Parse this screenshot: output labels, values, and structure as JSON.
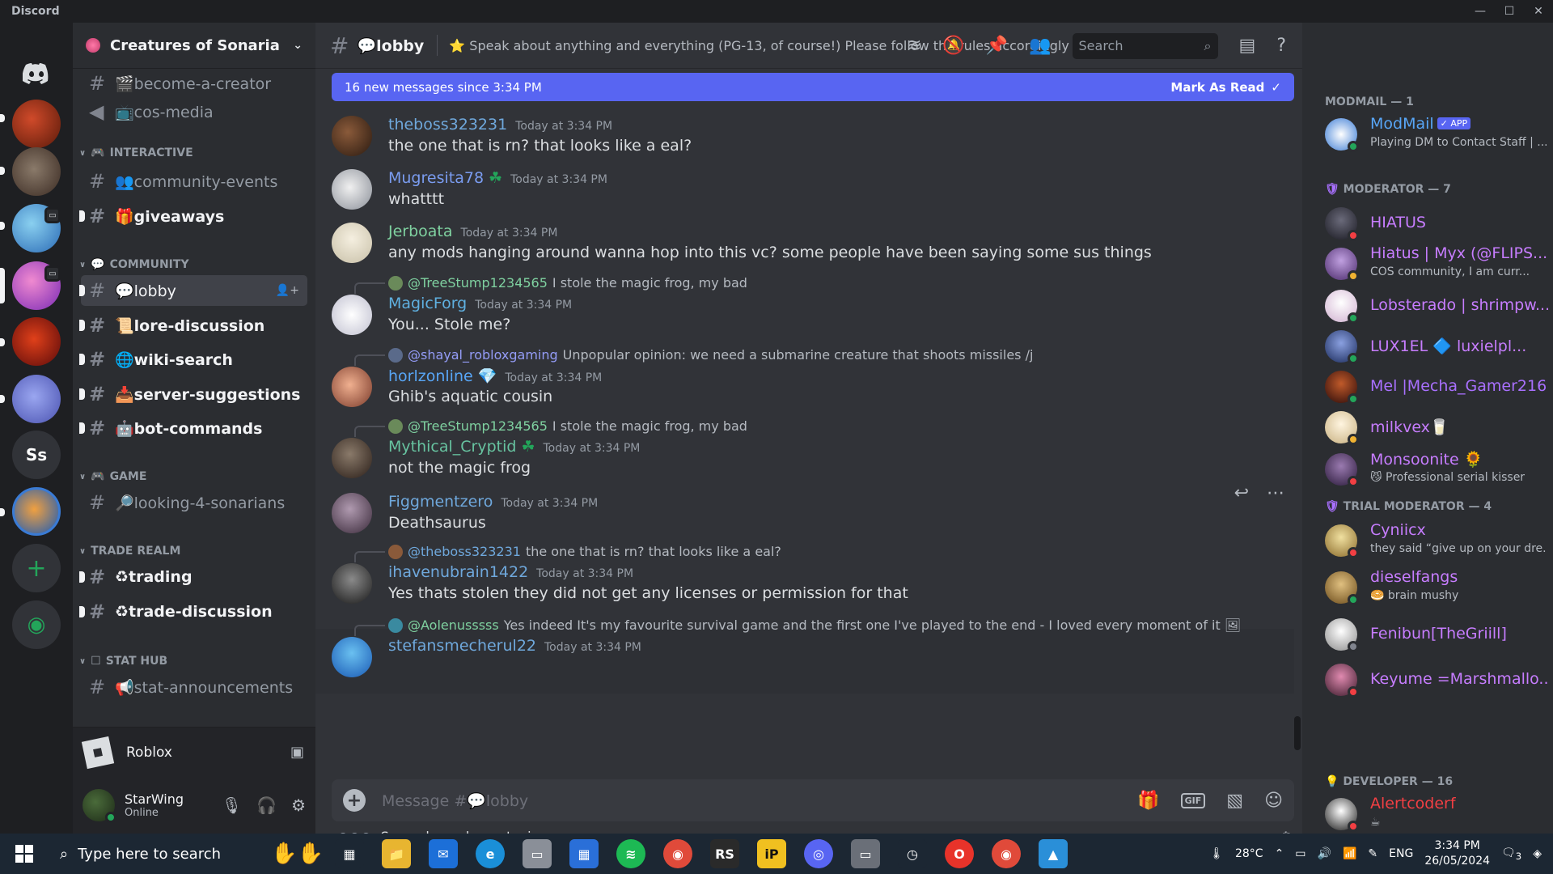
{
  "window": {
    "app_name": "Discord",
    "minimize": "—",
    "maximize": "☐",
    "close": "✕"
  },
  "guilds": [
    {
      "label": "",
      "color": "#5865f2",
      "icon": "discord-icon"
    },
    {
      "label": "",
      "color": "#8a2a1a",
      "icon": "server-icon"
    },
    {
      "label": "",
      "color": "#6b5a4a",
      "icon": "server-icon"
    },
    {
      "label": "",
      "color": "#3a7bd5",
      "icon": "server-icon"
    },
    {
      "label": "",
      "color": "#b04ad1",
      "icon": "server-icon"
    },
    {
      "label": "",
      "color": "#a11818",
      "icon": "server-icon"
    },
    {
      "label": "",
      "color": "#6c7bd8",
      "icon": "server-icon"
    },
    {
      "label": "Ss",
      "color": "#313338",
      "icon": "text-icon"
    },
    {
      "label": "",
      "color": "#2f7fe0",
      "icon": "server-icon"
    },
    {
      "label": "+",
      "color": "#313338",
      "icon": "add-server-icon"
    },
    {
      "label": "◉",
      "color": "#313338",
      "icon": "discover-icon"
    }
  ],
  "server": {
    "name": "Creatures of Sonaria",
    "chevron": "⌄"
  },
  "categories": [
    {
      "label": "INTERACTIVE",
      "emoji": "🎮"
    },
    {
      "label": "COMMUNITY",
      "emoji": "💬"
    },
    {
      "label": "GAME",
      "emoji": "🎮"
    },
    {
      "label": "TRADE REALM",
      "emoji": ""
    },
    {
      "label": "STAT HUB",
      "emoji": "☐"
    }
  ],
  "channels": [
    {
      "label": "🎬become-a-creator"
    },
    {
      "label": "📺cos-media"
    },
    {
      "label": "👥community-events"
    },
    {
      "label": "🎁giveaways"
    },
    {
      "label": "💬lobby"
    },
    {
      "label": "📜lore-discussion"
    },
    {
      "label": "🌐wiki-search"
    },
    {
      "label": "📥server-suggestions"
    },
    {
      "label": "🤖bot-commands"
    },
    {
      "label": "🔎looking-4-sonarians"
    },
    {
      "label": "♻trading"
    },
    {
      "label": "♻trade-discussion"
    },
    {
      "label": "📢stat-announcements"
    }
  ],
  "activity": {
    "name": "Roblox"
  },
  "user": {
    "name": "StarWing",
    "status": "Online"
  },
  "header": {
    "channel": "💬lobby",
    "topic": "⭐ Speak about anything and everything (PG-13, of course!) Please follow the rules accordingly as well.",
    "search_placeholder": "Search"
  },
  "newbar": {
    "text": "16 new messages since 3:34 PM",
    "action": "Mark As Read"
  },
  "messages": [
    {
      "name": "theboss323231",
      "time": "Today at 3:34 PM",
      "text": "the one that is rn? that looks like a eal?",
      "color": "#6fa8dc",
      "avatar": "#5a3a2a"
    },
    {
      "name": "Mugresita78",
      "time": "Today at 3:34 PM",
      "text": "whatttt",
      "color": "#7a9cf0",
      "avatar": "#cfd3d8"
    },
    {
      "name": "Jerboata",
      "time": "Today at 3:34 PM",
      "text": "any mods hanging around wanna hop into this vc? some people have been saying some sus things",
      "color": "#7fd1a0",
      "avatar": "#e8e1d0"
    },
    {
      "name": "MagicForg",
      "time": "Today at 3:34 PM",
      "text": "You... Stole me?",
      "color": "#5fb0e0",
      "avatar": "#e9e9ef"
    },
    {
      "name": "horlzonline",
      "time": "Today at 3:34 PM",
      "text": "Ghib's aquatic cousin",
      "color": "#58a6f7",
      "avatar": "#d08a6a"
    },
    {
      "name": "Mythical_Cryptid",
      "time": "Today at 3:34 PM",
      "text": "not the magic frog",
      "color": "#67c3a0",
      "avatar": "#4a3a2e"
    },
    {
      "name": "Figgmentzero",
      "time": "Today at 3:34 PM",
      "text": "Deathsaurus",
      "color": "#6fa8dc",
      "avatar": "#4a3a4a"
    },
    {
      "name": "ihavenubrain1422",
      "time": "Today at 3:34 PM",
      "text": "Yes thats stolen they did not get any licenses or permission for that",
      "color": "#6fa8dc",
      "avatar": "#2e2e2e"
    },
    {
      "name": "stefansmecherul22",
      "time": "Today at 3:34 PM",
      "text": "",
      "color": "#6fa8dc",
      "avatar": "#3aa0e0"
    }
  ],
  "replies": [
    {
      "name": "@TreeStump1234565",
      "text": "I stole the magic frog, my bad",
      "color": "#7fd1a0"
    },
    {
      "name": "@shayal_robloxgaming",
      "text": "Unpopular opinion: we need a submarine creature that shoots missiles /j",
      "color": "#949cf7"
    },
    {
      "name": "@TreeStump1234565",
      "text": "I stole the magic frog, my bad",
      "color": "#7fd1a0"
    },
    {
      "name": "@theboss323231",
      "text": "the one that is rn? that looks like a eal?",
      "color": "#6fa8dc"
    },
    {
      "name": "@Aolenusssss",
      "text": "Yes indeed It's my favourite survival game and the first one I've played to the end - I loved every moment of it 🖼",
      "color": "#7fd1a0"
    }
  ],
  "composer": {
    "placeholder": "Message #💬lobby",
    "typing": "Several people are typing..."
  },
  "member_groups": [
    {
      "label": "MODMAIL — 1"
    },
    {
      "label": "MODERATOR — 7"
    },
    {
      "label": "TRIAL MODERATOR — 4"
    },
    {
      "label": "DEVELOPER — 16"
    }
  ],
  "members": [
    {
      "name": "ModMail",
      "sub": "Playing DM to Contact Staff | ...",
      "color": "#58a6f7",
      "avatar": "#3a7bd5",
      "status": "#23a55a",
      "badge": "✓ APP"
    },
    {
      "name": "HIATUS",
      "sub": "",
      "color": "#c77dff",
      "avatar": "#2a2a33",
      "status": "#f23f43"
    },
    {
      "name": "Hiatus | Myx (@FLIPS...",
      "sub": "COS community, I am curr...",
      "color": "#c77dff",
      "avatar": "#8a6ab0",
      "status": "#f0b232"
    },
    {
      "name": "Lobsterado | shrimpw...",
      "sub": "",
      "color": "#c77dff",
      "avatar": "#f0e6f0",
      "status": "#23a55a"
    },
    {
      "name": "LUX1EL 🔷 luxielpl...",
      "sub": "",
      "color": "#c77dff",
      "avatar": "#2a3a6a",
      "status": "#23a55a"
    },
    {
      "name": "Mel |Mecha_Gamer216|",
      "sub": "",
      "color": "#c77dff",
      "avatar": "#6a2a1a",
      "status": "#23a55a"
    },
    {
      "name": "milkvex🥛",
      "sub": "",
      "color": "#c77dff",
      "avatar": "#e6d5b0",
      "status": "#f0b232"
    },
    {
      "name": "Monsoonite 🌻",
      "sub": "😼 Professional serial kisser",
      "color": "#c77dff",
      "avatar": "#5a3a6a",
      "status": "#f23f43"
    },
    {
      "name": "Cyniicx",
      "sub": "they said “give up on your dre...",
      "color": "#c77dff",
      "avatar": "#c0a060",
      "status": "#f23f43"
    },
    {
      "name": "dieselfangs",
      "sub": "🥯 brain mushy",
      "color": "#c77dff",
      "avatar": "#a07a3a",
      "status": "#23a55a"
    },
    {
      "name": "Fenibun[TheGriill]",
      "sub": "",
      "color": "#c77dff",
      "avatar": "#d0d0d0",
      "status": "#80848e"
    },
    {
      "name": "Keyume =Marshmallo...",
      "sub": "",
      "color": "#c77dff",
      "avatar": "#6a3a5a",
      "status": "#f23f43"
    },
    {
      "name": "Alertcoderf",
      "sub": "☕",
      "color": "#f23f43",
      "avatar": "#1a1a1a",
      "status": "#f23f43"
    }
  ],
  "taskbar": {
    "search": "Type here to search",
    "weather": "28°C",
    "lang": "ENG",
    "time": "3:34 PM",
    "date": "26/05/2024",
    "notif": "3",
    "apps": [
      {
        "label": "▦",
        "color": "#1c2733"
      },
      {
        "label": "📁",
        "color": "#e8b530"
      },
      {
        "label": "✉",
        "color": "#1c6fd8"
      },
      {
        "label": "e",
        "color": "#1a8fd8"
      },
      {
        "label": "▭",
        "color": "#8a8f98"
      },
      {
        "label": "▦",
        "color": "#2a6fd8"
      },
      {
        "label": "≋",
        "color": "#1db954"
      },
      {
        "label": "◉",
        "color": "#e04a3a"
      },
      {
        "label": "RS",
        "color": "#2a2a2a"
      },
      {
        "label": "iP",
        "color": "#f0c020"
      },
      {
        "label": "◎",
        "color": "#5865f2"
      },
      {
        "label": "▭",
        "color": "#6a6f78"
      },
      {
        "label": "◷",
        "color": "#1c2733"
      },
      {
        "label": "O",
        "color": "#e8332a"
      },
      {
        "label": "◉",
        "color": "#e04a3a"
      },
      {
        "label": "▲",
        "color": "#2a8fd8"
      }
    ]
  }
}
